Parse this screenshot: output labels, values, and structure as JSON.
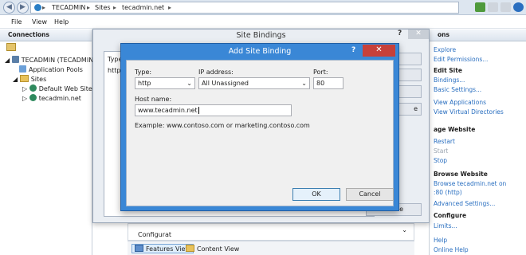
{
  "addressbar": {
    "crumbs": [
      "TECADMIN",
      "Sites",
      "tecadmin.net"
    ],
    "sep": "▸"
  },
  "menu": [
    "File",
    "View",
    "Help"
  ],
  "left_panel": {
    "header": "Connections",
    "tree": [
      "TECADMIN (TECADMIN",
      "Application Pools",
      "Sites",
      "Default Web Site",
      "tecadmin.net"
    ]
  },
  "right_panel": {
    "header": "ons",
    "items": [
      {
        "type": "link",
        "text": "Explore"
      },
      {
        "type": "link",
        "text": "Edit Permissions..."
      },
      {
        "type": "head",
        "text": "Edit Site"
      },
      {
        "type": "link",
        "text": "Bindings..."
      },
      {
        "type": "link",
        "text": "Basic Settings..."
      },
      {
        "type": "link",
        "text": "View Applications"
      },
      {
        "type": "link",
        "text": "View Virtual Directories"
      },
      {
        "type": "head",
        "text": "age Website"
      },
      {
        "type": "link",
        "text": "Restart"
      },
      {
        "type": "dis",
        "text": "Start"
      },
      {
        "type": "link",
        "text": "Stop"
      },
      {
        "type": "head",
        "text": "Browse Website"
      },
      {
        "type": "link",
        "text": "Browse tecadmin.net on"
      },
      {
        "type": "link",
        "text": ":80 (http)"
      },
      {
        "type": "link",
        "text": "Advanced Settings..."
      },
      {
        "type": "head",
        "text": "Configure"
      },
      {
        "type": "link",
        "text": "Limits..."
      },
      {
        "type": "link",
        "text": "Help"
      },
      {
        "type": "link",
        "text": "Online Help"
      }
    ]
  },
  "site_bindings": {
    "title": "Site Bindings",
    "help": "?",
    "col_type": "Type",
    "row_type": "http",
    "btn_close": "Close",
    "btn_e": "e"
  },
  "add_binding": {
    "title": "Add Site Binding",
    "help": "?",
    "type_label": "Type:",
    "type_value": "http",
    "ip_label": "IP address:",
    "ip_value": "All Unassigned",
    "port_label": "Port:",
    "port_value": "80",
    "host_label": "Host name:",
    "host_value": "www.tecadmin.net",
    "example": "Example: www.contoso.com or marketing.contoso.com",
    "ok": "OK",
    "cancel": "Cancel"
  },
  "bottom": {
    "features_view": "Features View",
    "content_view": "Content View",
    "partial": "Configurat"
  }
}
